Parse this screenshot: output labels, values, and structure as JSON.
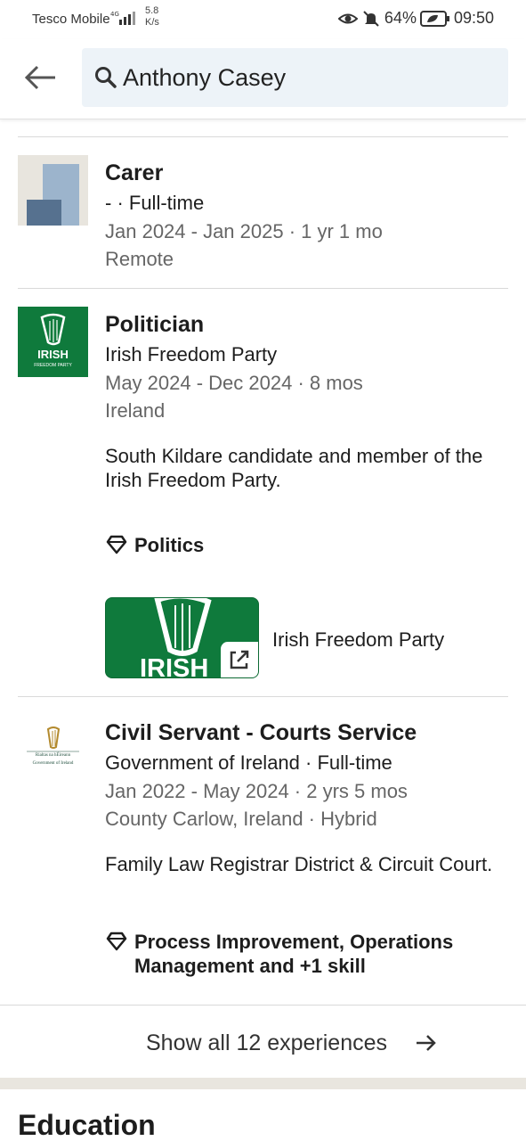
{
  "status_bar": {
    "carrier": "Tesco Mobile",
    "network": "4G",
    "speed_value": "5.8",
    "speed_unit": "K/s",
    "battery": "64%",
    "time": "09:50"
  },
  "header": {
    "search_query": "Anthony Casey"
  },
  "experiences": [
    {
      "title": "Carer",
      "company_line": "- · Full-time",
      "dates": "Jan 2024 - Jan 2025 · 1 yr 1 mo",
      "location": "Remote"
    },
    {
      "title": "Politician",
      "company_line": "Irish Freedom Party",
      "dates": "May 2024 - Dec 2024 · 8 mos",
      "location": "Ireland",
      "description": "South Kildare candidate and member of the Irish Freedom Party.",
      "skills": "Politics",
      "logo_text": "IRISH",
      "logo_subtext": "FREEDOM PARTY",
      "media": {
        "title": "Irish Freedom Party",
        "thumb_text": "IRISH"
      }
    },
    {
      "title": "Civil Servant - Courts Service",
      "company_line": "Government of Ireland · Full-time",
      "dates": "Jan 2022 - May 2024 · 2 yrs 5 mos",
      "location": "County Carlow, Ireland · Hybrid",
      "description": "Family Law Registrar District & Circuit Court.",
      "skills": "Process Improvement, Operations Management and +1 skill",
      "logo_text_1": "Rialtas na hÉireann",
      "logo_text_2": "Government of Ireland"
    }
  ],
  "show_all_label": "Show all 12 experiences",
  "next_section_title": "Education",
  "colors": {
    "brand_green": "#0f7a3c",
    "search_bg": "#edf3f8",
    "muted_text": "#666666"
  }
}
